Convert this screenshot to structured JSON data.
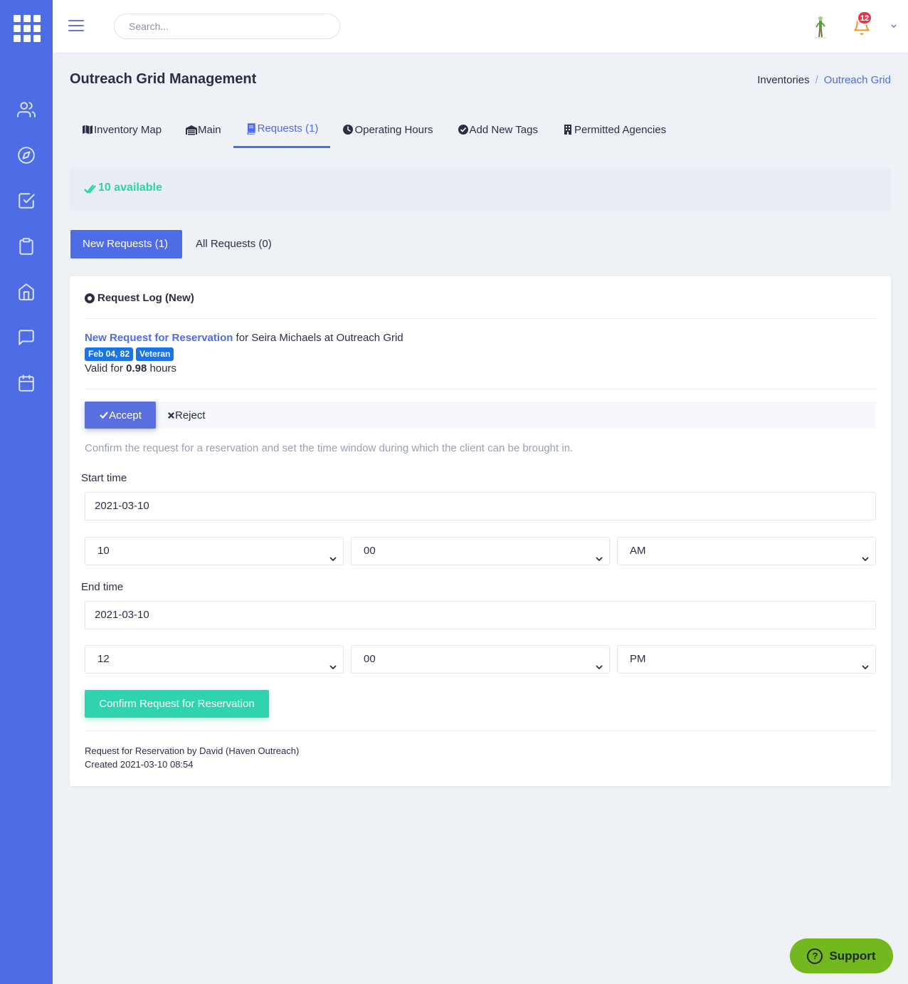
{
  "colors": {
    "primary": "#4e6ce6",
    "success": "#2fd4ae",
    "support": "#73b81e",
    "badge": "#1a73e8",
    "danger": "#e5364a"
  },
  "topbar": {
    "search_placeholder": "Search...",
    "notification_count": "12"
  },
  "header": {
    "title": "Outreach Grid Management"
  },
  "breadcrumb": {
    "items": [
      "Inventories",
      "Outreach Grid"
    ],
    "separator": "/"
  },
  "tabs": [
    {
      "label": "Inventory Map",
      "icon": "map-icon"
    },
    {
      "label": "Main",
      "icon": "garage-icon"
    },
    {
      "label": "Requests (1)",
      "icon": "book-icon"
    },
    {
      "label": "Operating Hours",
      "icon": "clock-icon"
    },
    {
      "label": "Add New Tags",
      "icon": "check-circle-icon"
    },
    {
      "label": "Permitted Agencies",
      "icon": "building-icon"
    }
  ],
  "availability": {
    "text": "10 available"
  },
  "subtabs": {
    "new": "New Requests (1)",
    "all": "All Requests (0)"
  },
  "card": {
    "title": "Request Log (New)",
    "request_link": "New Request for Reservation",
    "request_rest": " for Seira Michaels at Outreach Grid",
    "badges": [
      "Feb 04, 82",
      "Veteran"
    ],
    "valid_prefix": "Valid for ",
    "valid_value": "0.98",
    "valid_suffix": " hours",
    "accept_label": "Accept",
    "reject_label": "Reject",
    "helper": "Confirm the request for a reservation and set the time window during which the client can be brought in.",
    "start": {
      "label": "Start time",
      "date": "2021-03-10",
      "hour": "10",
      "minute": "00",
      "ampm": "AM"
    },
    "end": {
      "label": "End time",
      "date": "2021-03-10",
      "hour": "12",
      "minute": "00",
      "ampm": "PM"
    },
    "confirm_label": "Confirm Request for Reservation",
    "footer_line1": "Request for Reservation by David (Haven Outreach)",
    "footer_line2": "Created 2021-03-10 08:54"
  },
  "support": {
    "label": "Support"
  }
}
